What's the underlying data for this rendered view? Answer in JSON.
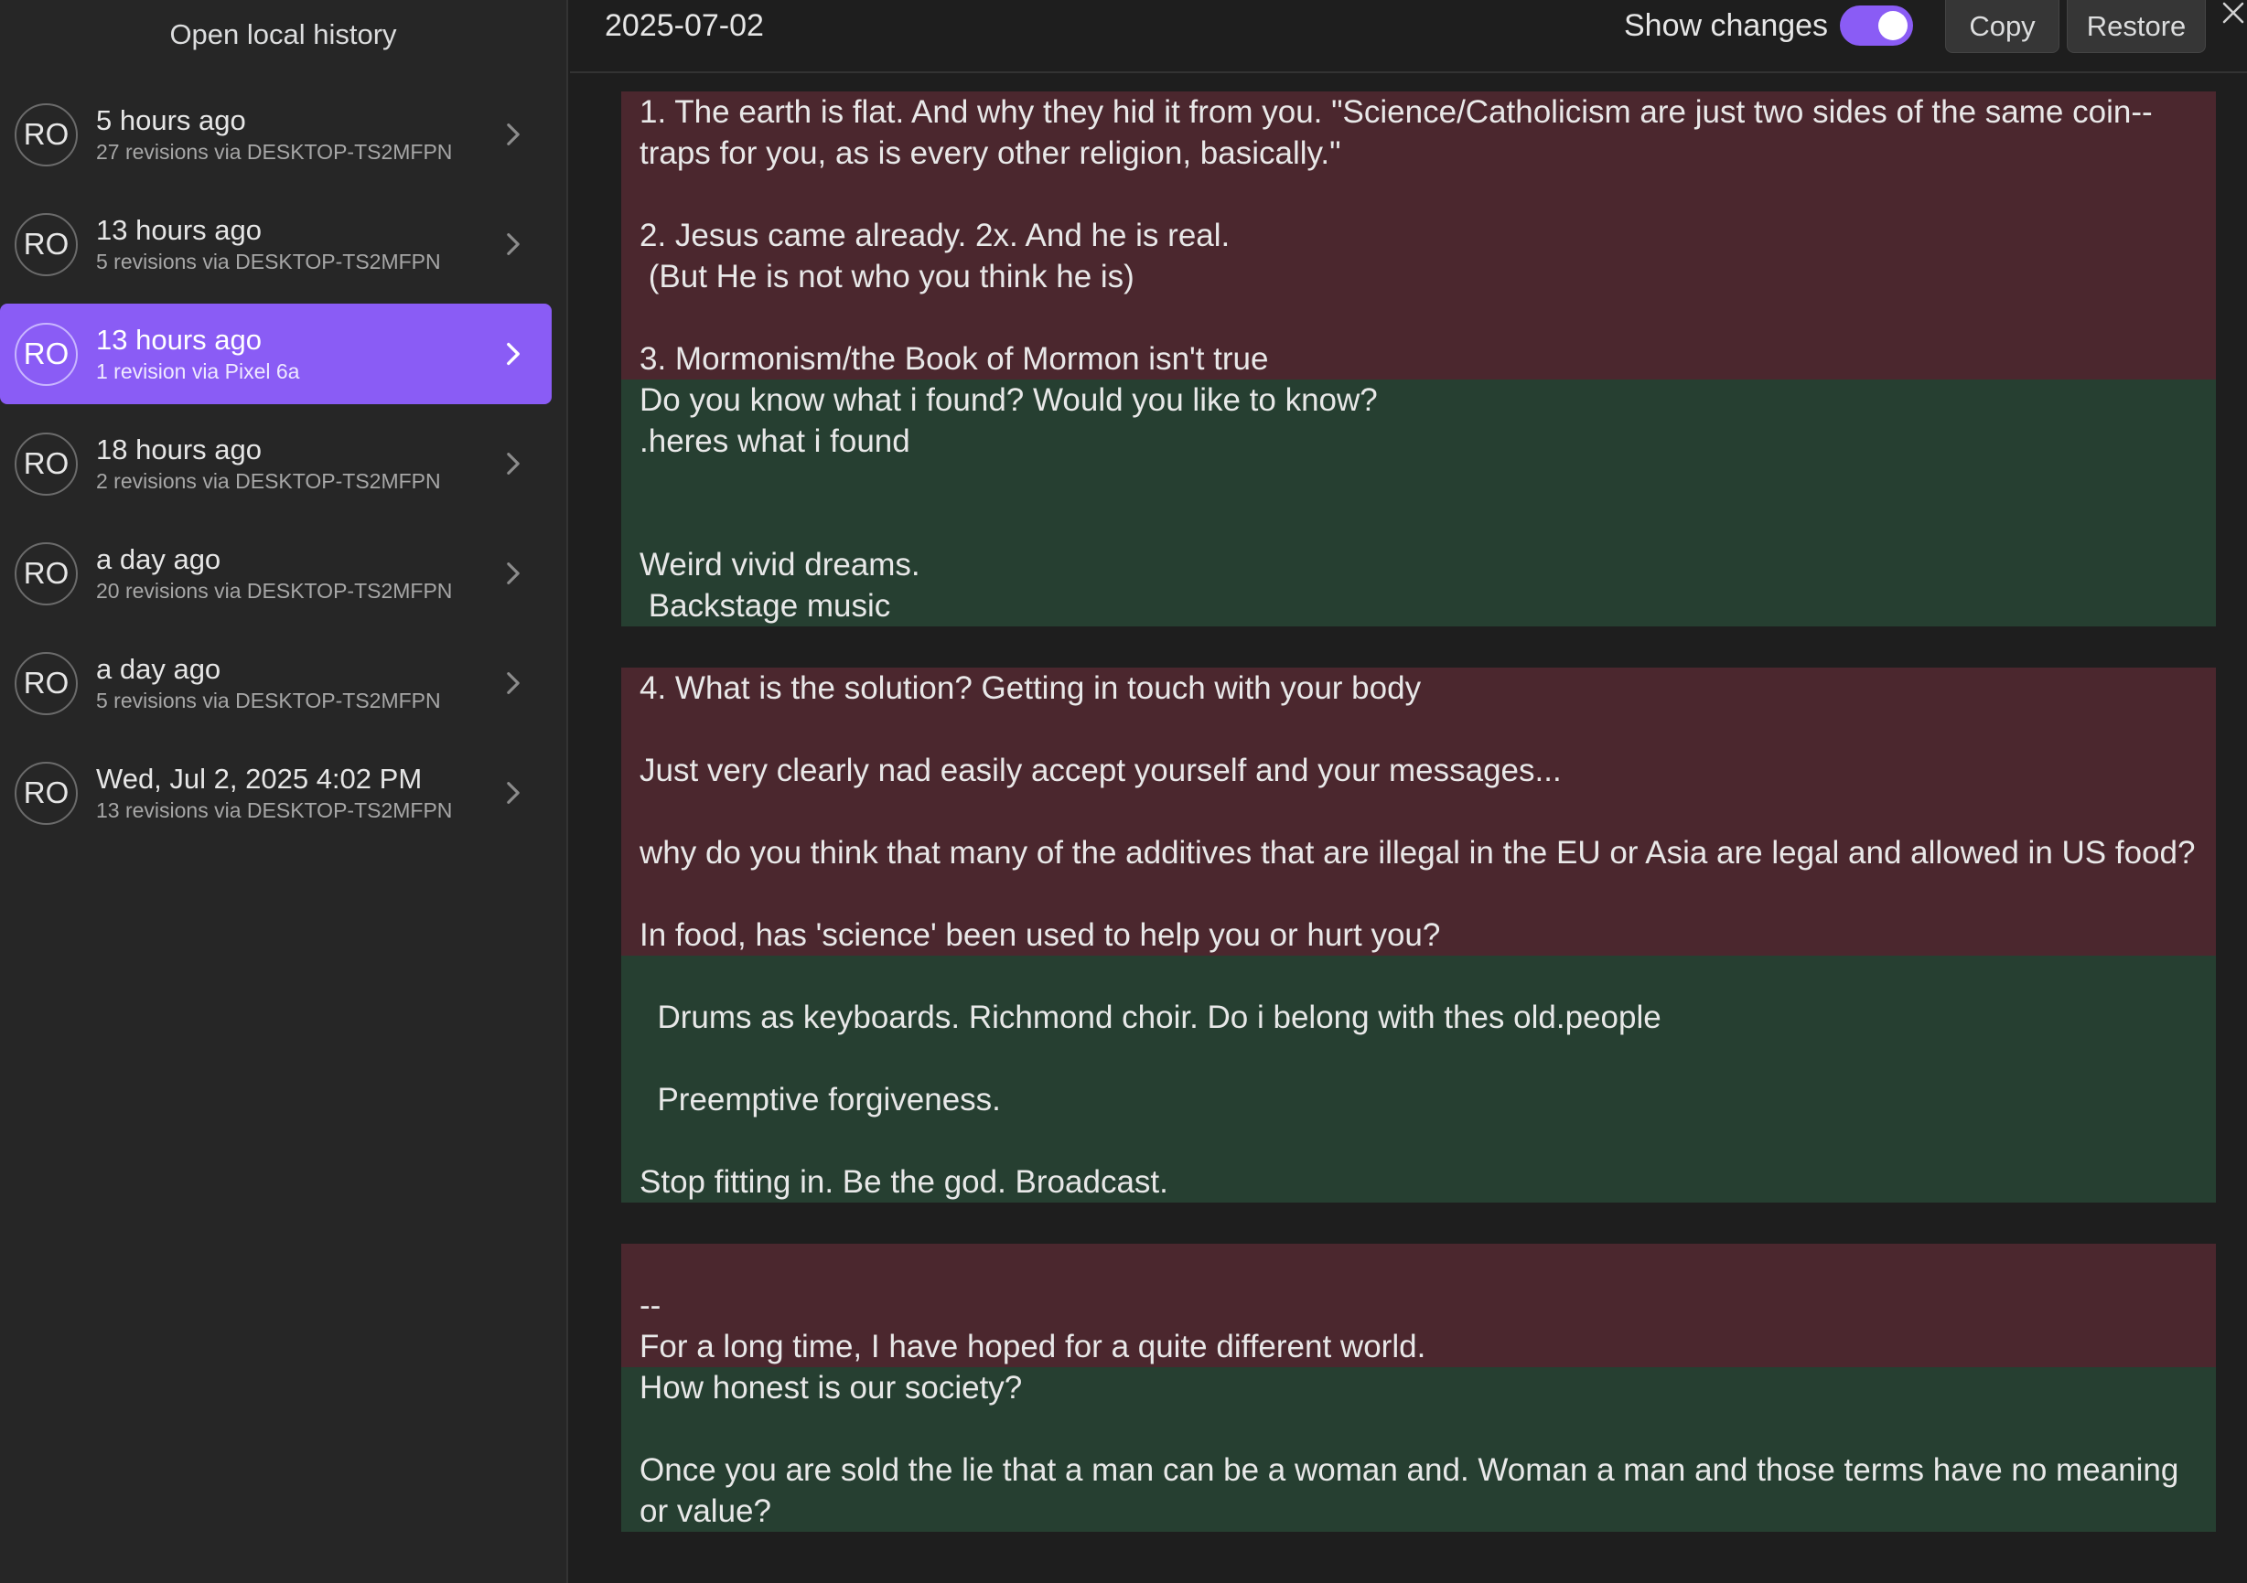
{
  "sidebar": {
    "title": "Open local history",
    "items": [
      {
        "avatar": "RO",
        "title": "5 hours ago",
        "subtitle": "27 revisions via DESKTOP-TS2MFPN",
        "active": false
      },
      {
        "avatar": "RO",
        "title": "13 hours ago",
        "subtitle": "5 revisions via DESKTOP-TS2MFPN",
        "active": false
      },
      {
        "avatar": "RO",
        "title": "13 hours ago",
        "subtitle": "1 revision via Pixel 6a",
        "active": true
      },
      {
        "avatar": "RO",
        "title": "18 hours ago",
        "subtitle": "2 revisions via DESKTOP-TS2MFPN",
        "active": false
      },
      {
        "avatar": "RO",
        "title": "a day ago",
        "subtitle": "20 revisions via DESKTOP-TS2MFPN",
        "active": false
      },
      {
        "avatar": "RO",
        "title": "a day ago",
        "subtitle": "5 revisions via DESKTOP-TS2MFPN",
        "active": false
      },
      {
        "avatar": "RO",
        "title": "Wed, Jul 2, 2025 4:02 PM",
        "subtitle": "13 revisions via DESKTOP-TS2MFPN",
        "active": false
      }
    ]
  },
  "toolbar": {
    "file_title": "2025-07-02",
    "show_changes_label": "Show changes",
    "show_changes_on": true,
    "copy_label": "Copy",
    "restore_label": "Restore",
    "close_icon": "close-icon"
  },
  "colors": {
    "accent": "#8a5cf5",
    "deleted_bg": "#4b272e",
    "added_bg": "#263f31"
  },
  "diff": {
    "b1": {
      "type": "deleted",
      "text": "1. The earth is flat. And why they hid it from you. \"Science/Catholicism are just two sides of the same coin--traps for you, as is every other religion, basically.\"\n\n2. Jesus came already. 2x. And he is real.\n (But He is not who you think he is)\n\n3. Mormonism/the Book of Mormon isn't true"
    },
    "b2": {
      "type": "added",
      "text": "Do you know what i found? Would you like to know?\n.heres what i found\n\n\nWeird vivid dreams.\n Backstage music"
    },
    "b3": {
      "type": "deleted",
      "text": "4. What is the solution? Getting in touch with your body\n\nJust very clearly nad easily accept yourself and your messages...\n\nwhy do you think that many of the additives that are illegal in the EU or Asia are legal and allowed in US food?\n\nIn food, has 'science' been used to help you or hurt you?"
    },
    "b4": {
      "type": "added",
      "text": "\n  Drums as keyboards. Richmond choir. Do i belong with thes old.people\n\n  Preemptive forgiveness.\n\nStop fitting in. Be the god. Broadcast.\n"
    },
    "b5": {
      "type": "deleted",
      "text": "\n--\nFor a long time, I have hoped for a quite different world."
    },
    "b6": {
      "type": "added",
      "text": "How honest is our society?\n\nOnce you are sold the lie that a man can be a woman and. Woman a man and those terms have no meaning or value?"
    }
  }
}
